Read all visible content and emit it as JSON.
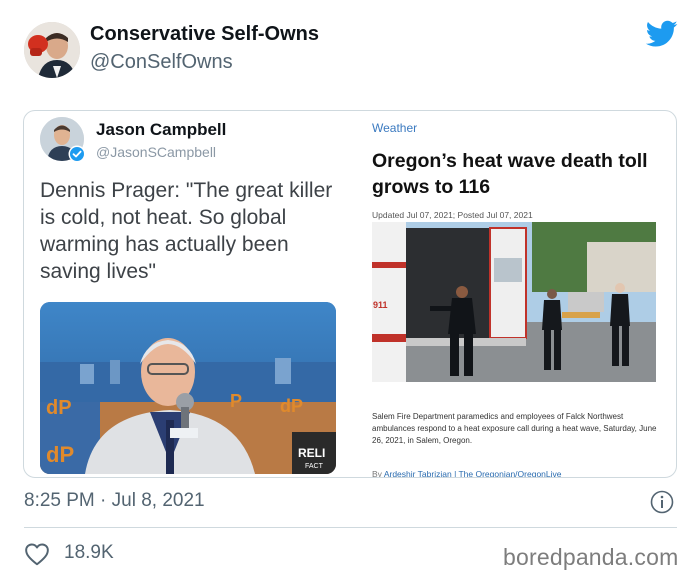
{
  "tweet": {
    "author_name": "Conservative Self-Owns",
    "author_handle": "@ConSelfOwns",
    "timestamp": "8:25 PM · Jul 8, 2021",
    "likes": "18.9K"
  },
  "embedded_tweet": {
    "author_name": "Jason Campbell",
    "author_handle": "@JasonSCampbell",
    "text": "Dennis Prager: \"The great killer is cold, not heat. So global warming has actually been saving lives\"",
    "photo_overlay_text": "RELI",
    "photo_overlay_text_2": "FACT"
  },
  "article": {
    "section": "Weather",
    "headline": "Oregon’s heat wave death toll grows to 116",
    "dateline": "Updated Jul 07, 2021; Posted Jul 07, 2021",
    "photo_vehicle_text": "911",
    "caption": "Salem Fire Department paramedics and employees of Falck Northwest ambulances respond to a heat exposure call during a heat wave, Saturday, June 26, 2021, in Salem, Oregon.",
    "byline_prefix": "By",
    "byline": "Ardeshir Tabrizian | The Oregonian/OregonLive"
  },
  "watermark": "boredpanda.com",
  "colors": {
    "twitter_blue": "#1d9bf0",
    "secondary_text": "#536471",
    "link_blue": "#3b7ac0",
    "border": "#cfd9de"
  },
  "icons": {
    "brand": "twitter-bird-icon",
    "verified": "verified-badge-icon",
    "info": "info-icon",
    "like": "heart-icon"
  }
}
